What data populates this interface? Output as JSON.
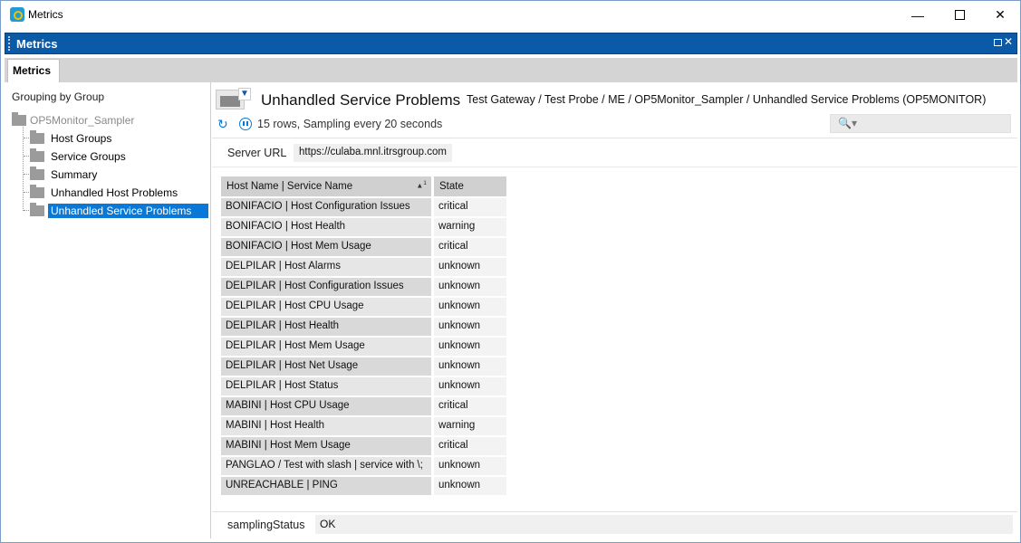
{
  "window": {
    "title": "Metrics"
  },
  "panel": {
    "title": "Metrics"
  },
  "tabs": [
    {
      "label": "Metrics"
    }
  ],
  "tree": {
    "heading": "Grouping by Group",
    "root": "OP5Monitor_Sampler",
    "children": [
      {
        "label": "Host Groups"
      },
      {
        "label": "Service Groups"
      },
      {
        "label": "Summary"
      },
      {
        "label": "Unhandled Host Problems"
      },
      {
        "label": "Unhandled Service Problems",
        "selected": true
      }
    ]
  },
  "view": {
    "title": "Unhandled Service Problems",
    "path": "Test Gateway / Test Probe / ME / OP5Monitor_Sampler / Unhandled Service Problems (OP5MONITOR)",
    "status": "15 rows, Sampling every 20 seconds",
    "search_placeholder": ""
  },
  "server": {
    "label": "Server URL",
    "value": "https://culaba.mnl.itrsgroup.com"
  },
  "table": {
    "columns": [
      "Host Name | Service Name",
      "State"
    ],
    "sort_indicator": "1",
    "rows": [
      {
        "host": "BONIFACIO | Host Configuration Issues",
        "state": "critical"
      },
      {
        "host": "BONIFACIO | Host Health",
        "state": "warning"
      },
      {
        "host": "BONIFACIO | Host Mem Usage",
        "state": "critical"
      },
      {
        "host": "DELPILAR | Host Alarms",
        "state": "unknown"
      },
      {
        "host": "DELPILAR | Host Configuration Issues",
        "state": "unknown"
      },
      {
        "host": "DELPILAR | Host CPU Usage",
        "state": "unknown"
      },
      {
        "host": "DELPILAR | Host Health",
        "state": "unknown"
      },
      {
        "host": "DELPILAR | Host Mem Usage",
        "state": "unknown"
      },
      {
        "host": "DELPILAR | Host Net Usage",
        "state": "unknown"
      },
      {
        "host": "DELPILAR | Host Status",
        "state": "unknown"
      },
      {
        "host": "MABINI | Host CPU Usage",
        "state": "critical"
      },
      {
        "host": "MABINI | Host Health",
        "state": "warning"
      },
      {
        "host": "MABINI | Host Mem Usage",
        "state": "critical"
      },
      {
        "host": "PANGLAO / Test with slash | service with \\;",
        "state": "unknown"
      },
      {
        "host": "UNREACHABLE | PING",
        "state": "unknown"
      }
    ]
  },
  "footer": {
    "label": "samplingStatus",
    "value": "OK"
  },
  "colors": {
    "panel_header": "#0a5aa8",
    "selection": "#0a78d7"
  }
}
